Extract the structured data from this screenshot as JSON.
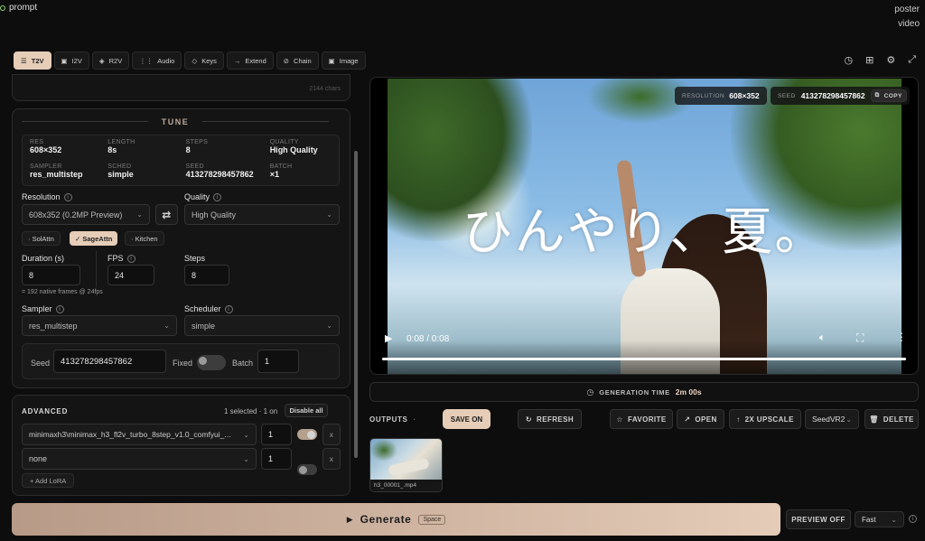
{
  "topbar": {
    "app_name": "prompt",
    "right_line1": "poster",
    "right_line2": "video"
  },
  "tabs": [
    {
      "label": "T2V",
      "icon": "menu-icon",
      "active": true
    },
    {
      "label": "I2V",
      "icon": "image-icon"
    },
    {
      "label": "R2V",
      "icon": "layers-icon"
    },
    {
      "label": "Audio",
      "icon": "audio-icon"
    },
    {
      "label": "Keys",
      "icon": "diamond-icon"
    },
    {
      "label": "Extend",
      "icon": "arrow-right-icon"
    },
    {
      "label": "Chain",
      "icon": "link-icon"
    },
    {
      "label": "Image",
      "icon": "image-icon"
    }
  ],
  "prompt": {
    "char_count": "2144 chars"
  },
  "tune": {
    "title": "TUNE",
    "summary": [
      {
        "k": "RES",
        "v": "608×352"
      },
      {
        "k": "LENGTH",
        "v": "8s"
      },
      {
        "k": "STEPS",
        "v": "8"
      },
      {
        "k": "QUALITY",
        "v": "High Quality"
      },
      {
        "k": "SAMPLER",
        "v": "res_multistep"
      },
      {
        "k": "SCHED",
        "v": "simple"
      },
      {
        "k": "SEED",
        "v": "413278298457862"
      },
      {
        "k": "BATCH",
        "v": "×1"
      }
    ],
    "resolution_label": "Resolution",
    "resolution_value": "608x352 (0.2MP Preview)",
    "quality_label": "Quality",
    "quality_value": "High Quality",
    "attn": {
      "sol": "· SolAttn",
      "sage": "✓ SageAttn",
      "kitchen": "· Kitchen"
    },
    "duration_label": "Duration (s)",
    "duration_value": "8",
    "fps_label": "FPS",
    "fps_value": "24",
    "steps_label": "Steps",
    "steps_value": "8",
    "frames_note": "= 192 native frames @ 24fps",
    "sampler_label": "Sampler",
    "sampler_value": "res_multistep",
    "scheduler_label": "Scheduler",
    "scheduler_value": "simple",
    "seed_label": "Seed",
    "seed_value": "413278298457862",
    "fixed_label": "Fixed",
    "batch_label": "Batch",
    "batch_value": "1"
  },
  "advanced": {
    "title": "ADVANCED",
    "status": "1 selected · 1 on",
    "disable_all": "Disable all",
    "loras": [
      {
        "name": "minimaxh3\\minimax_h3_fl2v_turbo_8step_v1.0_comfyui_...",
        "strength": "1",
        "on": true
      },
      {
        "name": "none",
        "strength": "1",
        "on": false
      }
    ],
    "add_label": "+ Add LoRA",
    "remove_label": "x"
  },
  "generate": {
    "label": "Generate",
    "shortcut": "Space"
  },
  "preview": {
    "label": "PREVIEW OFF",
    "mode": "Fast"
  },
  "video": {
    "res_key": "RESOLUTION",
    "res_val": "608×352",
    "seed_key": "SEED",
    "seed_val": "413278298457862",
    "copy": "COPY",
    "caption": "ひんやり、夏。",
    "time": "0:08 / 0:08",
    "progress": 1.0
  },
  "generation_time": {
    "label": "GENERATION TIME",
    "value": "2m 00s"
  },
  "outputs": {
    "label": "OUTPUTS",
    "save_on": "SAVE ON",
    "refresh": "REFRESH",
    "favorite": "FAVORITE",
    "open": "OPEN",
    "upscale": "2X UPSCALE",
    "upscaler": "SeedVR2",
    "delete": "DELETE",
    "items": [
      {
        "filename": "h3_00001_.mp4"
      }
    ]
  },
  "colors": {
    "accent": "#e8d3c0",
    "generate_bg": "#d8c1ad",
    "sage_active": "#e6cdb8"
  }
}
